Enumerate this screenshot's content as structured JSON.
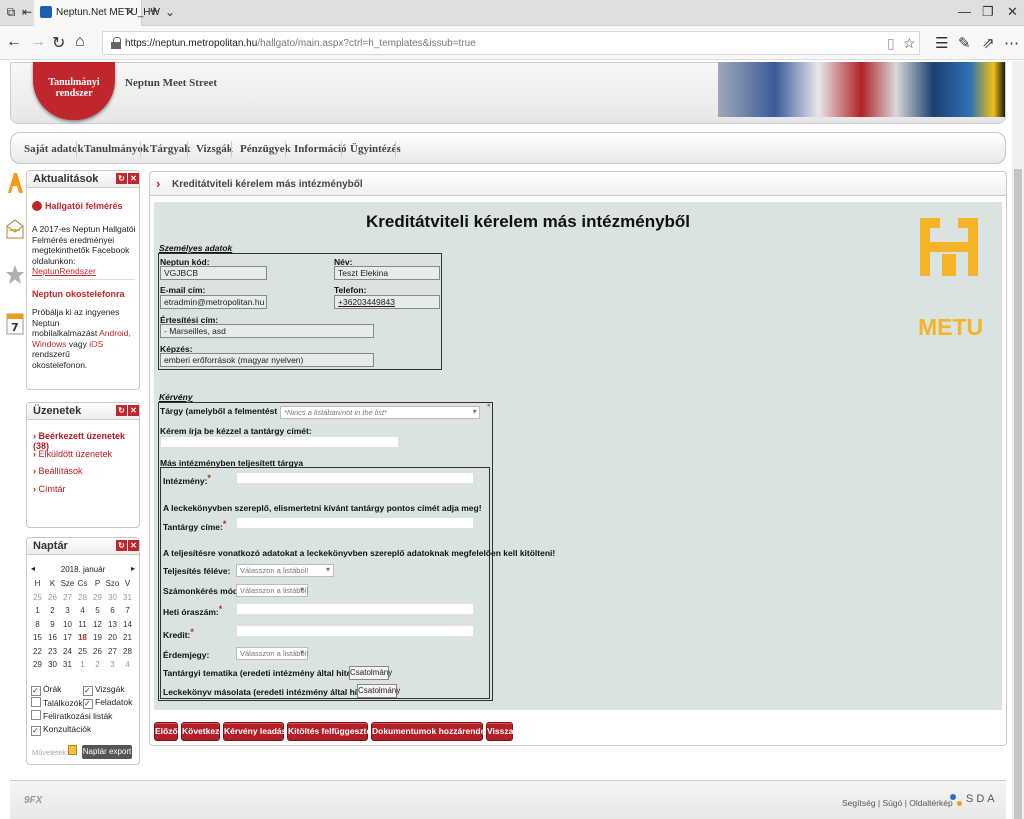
{
  "browser": {
    "tab_title": "Neptun.Net METU_HW",
    "url_host": "https://neptun.metropolitan.hu",
    "url_path": "/hallgato/main.aspx?ctrl=h_templates&issub=true"
  },
  "header": {
    "logo_text": "Tanulmányi rendszer",
    "subtitle": "Neptun Meet Street"
  },
  "menu": [
    "Saját adatok",
    "Tanulmányok",
    "Tárgyak",
    "Vizsgák",
    "Pénzügyek",
    "Információ",
    "Ügyintézés"
  ],
  "news": {
    "title": "Aktualitások",
    "item1_title": "Hallgatói felmérés",
    "item1_text1": "A 2017-es Neptun Hallgatói",
    "item1_text2": "Felmérés eredményei",
    "item1_text3": "megtekinthetők Facebook",
    "item1_text4": "oldalunkon:",
    "item1_link": "NeptunRendszer",
    "item2_title": "Neptun okostelefonra",
    "item2_text1": "Próbálja ki az ingyenes Neptun",
    "item2_text2": "mobilalkalmazást",
    "item2_android": "Android,",
    "item2_windows": "Windows",
    "item2_vagy": "vagy",
    "item2_ios": "iOS",
    "item2_text3": "rendszerű",
    "item2_text4": "okostelefonon."
  },
  "messages": {
    "title": "Üzenetek",
    "items": [
      "Beérkezett üzenetek (38)",
      "Elküldött üzenetek",
      "Beállítások",
      "Címtár"
    ]
  },
  "calendar": {
    "title": "Naptár",
    "month": "2018. január",
    "days": [
      "H",
      "K",
      "Sze",
      "Cs",
      "P",
      "Szo",
      "V"
    ],
    "weeks": [
      [
        "25",
        "26",
        "27",
        "28",
        "29",
        "30",
        "31"
      ],
      [
        "1",
        "2",
        "3",
        "4",
        "5",
        "6",
        "7"
      ],
      [
        "8",
        "9",
        "10",
        "11",
        "12",
        "13",
        "14"
      ],
      [
        "15",
        "16",
        "17",
        "18",
        "19",
        "20",
        "21"
      ],
      [
        "22",
        "23",
        "24",
        "25",
        "26",
        "27",
        "28"
      ],
      [
        "29",
        "30",
        "31",
        "1",
        "2",
        "3",
        "4"
      ]
    ],
    "checks": [
      "Órák",
      "Vizsgák",
      "Találkozók",
      "Feladatok",
      "Feliratkozási listák",
      "Konzultációk"
    ],
    "ops_label": "Műveletek:",
    "export_label": "Naptár export"
  },
  "panel": {
    "title": "Kreditátviteli kérelem más intézményből"
  },
  "form": {
    "title": "Kreditátviteli kérelem más intézményből",
    "personal_section": "Személyes adatok",
    "neptun_label": "Neptun kód:",
    "neptun_value": "VGJBCB",
    "name_label": "Név:",
    "name_value": "Teszt Elekina",
    "email_label": "E-mail cím:",
    "email_value": "etradmin@metropolitan.hu",
    "phone_label": "Telefon:",
    "phone_value": "+36203449843",
    "address_label": "Értesítési cím:",
    "address_value": "- Marseilles, asd",
    "training_label": "Képzés:",
    "training_value": "emberi erőforrások (magyar nyelven)",
    "request_section": "Kérvény",
    "subject_label": "Tárgy (amelyből a felmentést kéri):",
    "subject_placeholder": "*Nincs a listában/not in the list*",
    "subject_name_label": "Kérem írja be kézzel a tantárgy címét:",
    "other_section": "Más intézményben teljesített tárgya",
    "institution_label": "Intézmény:",
    "note1": "A leckekönyvben szereplő, elismertetni kívánt tantárgy pontos címét adja meg!",
    "course_title_label": "Tantárgy címe:",
    "note2": "A teljesítésre vonatkozó adatokat a leckekönyvben szereplő adatoknak megfelelően kell kitölteni!",
    "semester_label": "Teljesítés féléve:",
    "semester_value": "Válasszon a listából!",
    "exam_label": "Számonkérés módja:",
    "exam_value": "Válasszon a listából!",
    "hours_label": "Heti óraszám:",
    "credit_label": "Kredit:",
    "grade_label": "Érdemjegy:",
    "grade_value": "Válasszon a listából!",
    "syllabus_label": "Tantárgyi tematika (eredeti intézmény által hitelesített)",
    "attach_label": "Csatolmány",
    "transcript_label": "Leckekönyv másolata (eredeti intézmény által hitelesített)",
    "attach_label2": "Csatolmány"
  },
  "logo": {
    "text": "METU"
  },
  "actions": [
    "Előző",
    "Következő",
    "Kérvény leadása",
    "Kitöltés felfüggesztése",
    "Dokumentumok hozzárendelése",
    "Vissza"
  ],
  "footer": {
    "links": "Segítség | Súgó | Oldaltérkép",
    "brand_left": "9FX",
    "brand_right": "SDA"
  }
}
